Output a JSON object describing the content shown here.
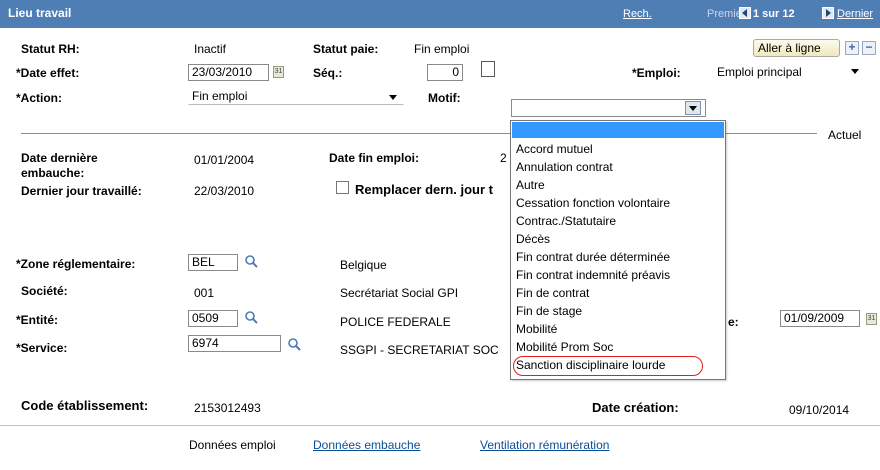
{
  "header": {
    "title": "Lieu travail",
    "rech": "Rech.",
    "premier": "Premier",
    "pager": "1 sur 12",
    "dernier": "Dernier"
  },
  "form": {
    "statut_rh_label": "Statut RH:",
    "statut_rh_value": "Inactif",
    "statut_paie_label": "Statut paie:",
    "statut_paie_value": "Fin emploi",
    "aller_btn": "Aller à ligne",
    "add_btn": "+",
    "remove_btn": "−",
    "date_effet_label": "*Date effet:",
    "date_effet_value": "23/03/2010",
    "seq_label": "Séq.:",
    "seq_value": "0",
    "emploi_label": "*Emploi:",
    "emploi_value": "Emploi principal",
    "action_label": "*Action:",
    "action_value": "Fin emploi",
    "motif_label": "Motif:",
    "motif_value": "",
    "actuel": "Actuel",
    "date_derniere_embauche_label_1": "Date dernière",
    "date_derniere_embauche_label_2": "embauche:",
    "date_derniere_embauche_value": "01/01/2004",
    "date_fin_emploi_label": "Date fin emploi:",
    "date_fin_emploi_value": "2",
    "dernier_jour_label": "Dernier jour travaillé:",
    "dernier_jour_value": "22/03/2010",
    "remplacer_label": "Remplacer dern. jour t",
    "zone_label": "*Zone réglementaire:",
    "zone_value": "BEL",
    "zone_desc": "Belgique",
    "societe_label": "Société:",
    "societe_value": "001",
    "societe_desc": "Secrétariat Social GPI",
    "entite_label": "*Entité:",
    "entite_value": "0509",
    "entite_desc": "POLICE FEDERALE",
    "entite_date_suffix": "e:",
    "entite_date_value": "01/09/2009",
    "service_label": "*Service:",
    "service_value": "6974",
    "service_desc": "SSGPI - SECRETARIAT SOC",
    "code_etab_label": "Code établissement:",
    "code_etab_value": "2153012493",
    "date_creation_label": "Date création:",
    "date_creation_value": "09/10/2014"
  },
  "motif_options": [
    "",
    "Accord mutuel",
    "Annulation contrat",
    "Autre",
    "Cessation fonction volontaire",
    "Contrac./Statutaire",
    "Décès",
    "Fin contrat durée déterminée",
    "Fin contrat indemnité préavis",
    "Fin de contrat",
    "Fin de stage",
    "Mobilité",
    "Mobilité Prom Soc",
    "Sanction disciplinaire lourde"
  ],
  "footer": {
    "donnees_emploi": "Données emploi",
    "donnees_embauche": "Données embauche",
    "ventilation": "Ventilation rémunération"
  },
  "colors": {
    "header_bg": "#4f7eb4",
    "selected_option": "#3399ff",
    "highlight_circle": "#e02020",
    "link": "#0b4e96"
  }
}
